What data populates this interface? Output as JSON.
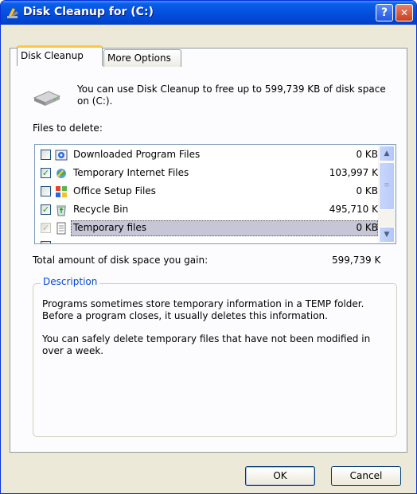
{
  "window": {
    "title": "Disk Cleanup for  (C:)",
    "help_label": "?",
    "close_label": "✕"
  },
  "tabs": [
    {
      "label": "Disk Cleanup",
      "active": true
    },
    {
      "label": "More Options",
      "active": false
    }
  ],
  "intro_text": "You can use Disk Cleanup to free up to 599,739 KB of disk space on  (C:).",
  "files_label": "Files to delete:",
  "files": [
    {
      "name": "Downloaded Program Files",
      "size": "0 KB",
      "checked": false,
      "icon": "downloaded-program-files-icon"
    },
    {
      "name": "Temporary Internet Files",
      "size": "103,997 K",
      "checked": true,
      "icon": "temporary-internet-files-icon"
    },
    {
      "name": "Office Setup Files",
      "size": "0 KB",
      "checked": false,
      "icon": "office-setup-files-icon"
    },
    {
      "name": "Recycle Bin",
      "size": "495,710 K",
      "checked": true,
      "icon": "recycle-bin-icon"
    },
    {
      "name": "Temporary files",
      "size": "0 KB",
      "checked": true,
      "disabled": true,
      "selected": true,
      "icon": "temporary-files-icon"
    }
  ],
  "total_label": "Total amount of disk space you gain:",
  "total_value": "599,739 K",
  "description": {
    "title": "Description",
    "para1": "Programs sometimes store temporary information in a TEMP folder. Before a program closes, it usually deletes this information.",
    "para2": "You can safely delete temporary files that have not been modified in over a week."
  },
  "buttons": {
    "ok": "OK",
    "cancel": "Cancel"
  },
  "colors": {
    "titlebar": "#0550de",
    "dialog_bg": "#ece9d8",
    "group_title": "#0046d5",
    "selection": "#c6c6d6"
  }
}
